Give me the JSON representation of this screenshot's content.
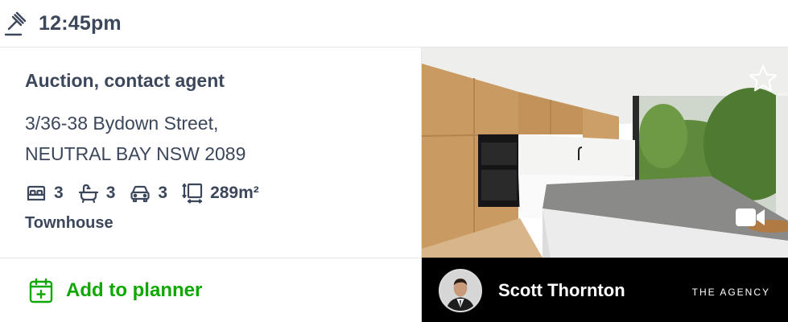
{
  "auction": {
    "icon": "gavel-icon",
    "time": "12:45pm"
  },
  "listing": {
    "price": "Auction, contact agent",
    "address_line1": "3/36-38 Bydown Street,",
    "address_line2": "NEUTRAL BAY NSW 2089",
    "features": {
      "bedrooms": "3",
      "bathrooms": "3",
      "parking": "3",
      "land_size": "289m²"
    },
    "property_type": "Townhouse"
  },
  "planner": {
    "label": "Add to planner",
    "color": "#0ea800"
  },
  "photo": {
    "icons": [
      "star-icon",
      "video-icon"
    ]
  },
  "agent": {
    "name": "Scott Thornton",
    "agency": "THE AGENCY"
  },
  "colors": {
    "text": "#3c475b",
    "accent_green": "#0ea800",
    "agent_bar": "#000000"
  }
}
